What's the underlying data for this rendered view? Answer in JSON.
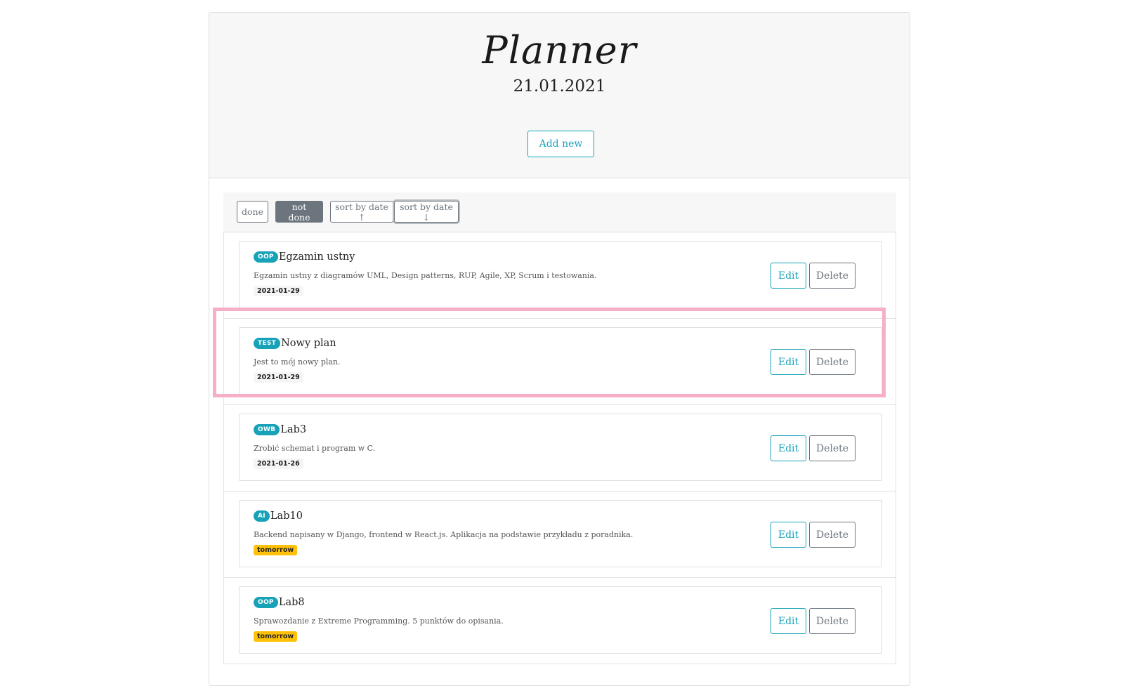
{
  "header": {
    "title": "Planner",
    "date": "21.01.2021",
    "add_button": "Add new"
  },
  "filters": {
    "done": "done",
    "not_done": "not done",
    "sort_asc": "sort by date ↑",
    "sort_desc": "sort by date ↓",
    "active": "not done"
  },
  "items": [
    {
      "category": "OOP",
      "title": "Egzamin ustny",
      "description": "Egzamin ustny z diagramów UML, Design patterns, RUP, Agile, XP, Scrum i testowania.",
      "date": "2021-01-29",
      "date_style": "default",
      "edit": "Edit",
      "delete": "Delete"
    },
    {
      "category": "TEST",
      "title": "Nowy plan",
      "description": "Jest to mój nowy plan.",
      "date": "2021-01-29",
      "date_style": "default",
      "edit": "Edit",
      "delete": "Delete"
    },
    {
      "category": "OWB",
      "title": "Lab3",
      "description": "Zrobić schemat i program w C.",
      "date": "2021-01-26",
      "date_style": "default",
      "edit": "Edit",
      "delete": "Delete"
    },
    {
      "category": "AI",
      "title": "Lab10",
      "description": "Backend napisany w Django, frontend w React.js. Aplikacja na podstawie przykładu z poradnika.",
      "date": "tomorrow",
      "date_style": "warning",
      "edit": "Edit",
      "delete": "Delete"
    },
    {
      "category": "OOP",
      "title": "Lab8",
      "description": "Sprawozdanie z Extreme Programming. 5 punktów do opisania.",
      "date": "tomorrow",
      "date_style": "warning",
      "edit": "Edit",
      "delete": "Delete"
    }
  ],
  "colors": {
    "accent": "#17a2b8",
    "secondary": "#6c757d",
    "warning": "#ffc107",
    "highlight": "#f7aec9"
  }
}
